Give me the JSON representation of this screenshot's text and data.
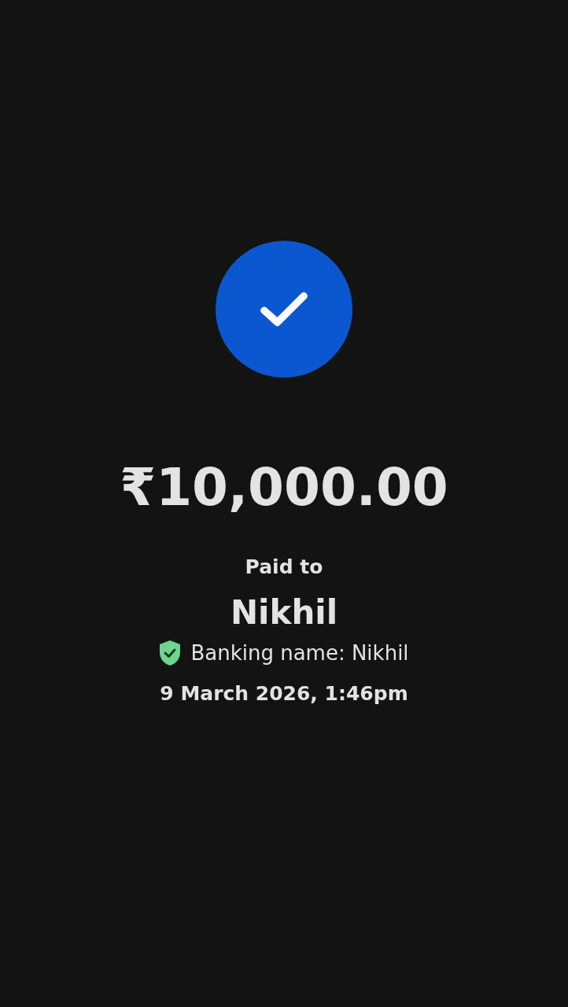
{
  "amount": "₹10,000.00",
  "paid_to_label": "Paid to",
  "payee": "Nikhil",
  "banking_name": {
    "text": "Banking name: Nikhil",
    "verified": true
  },
  "timestamp": "9 March 2026, 1:46pm"
}
